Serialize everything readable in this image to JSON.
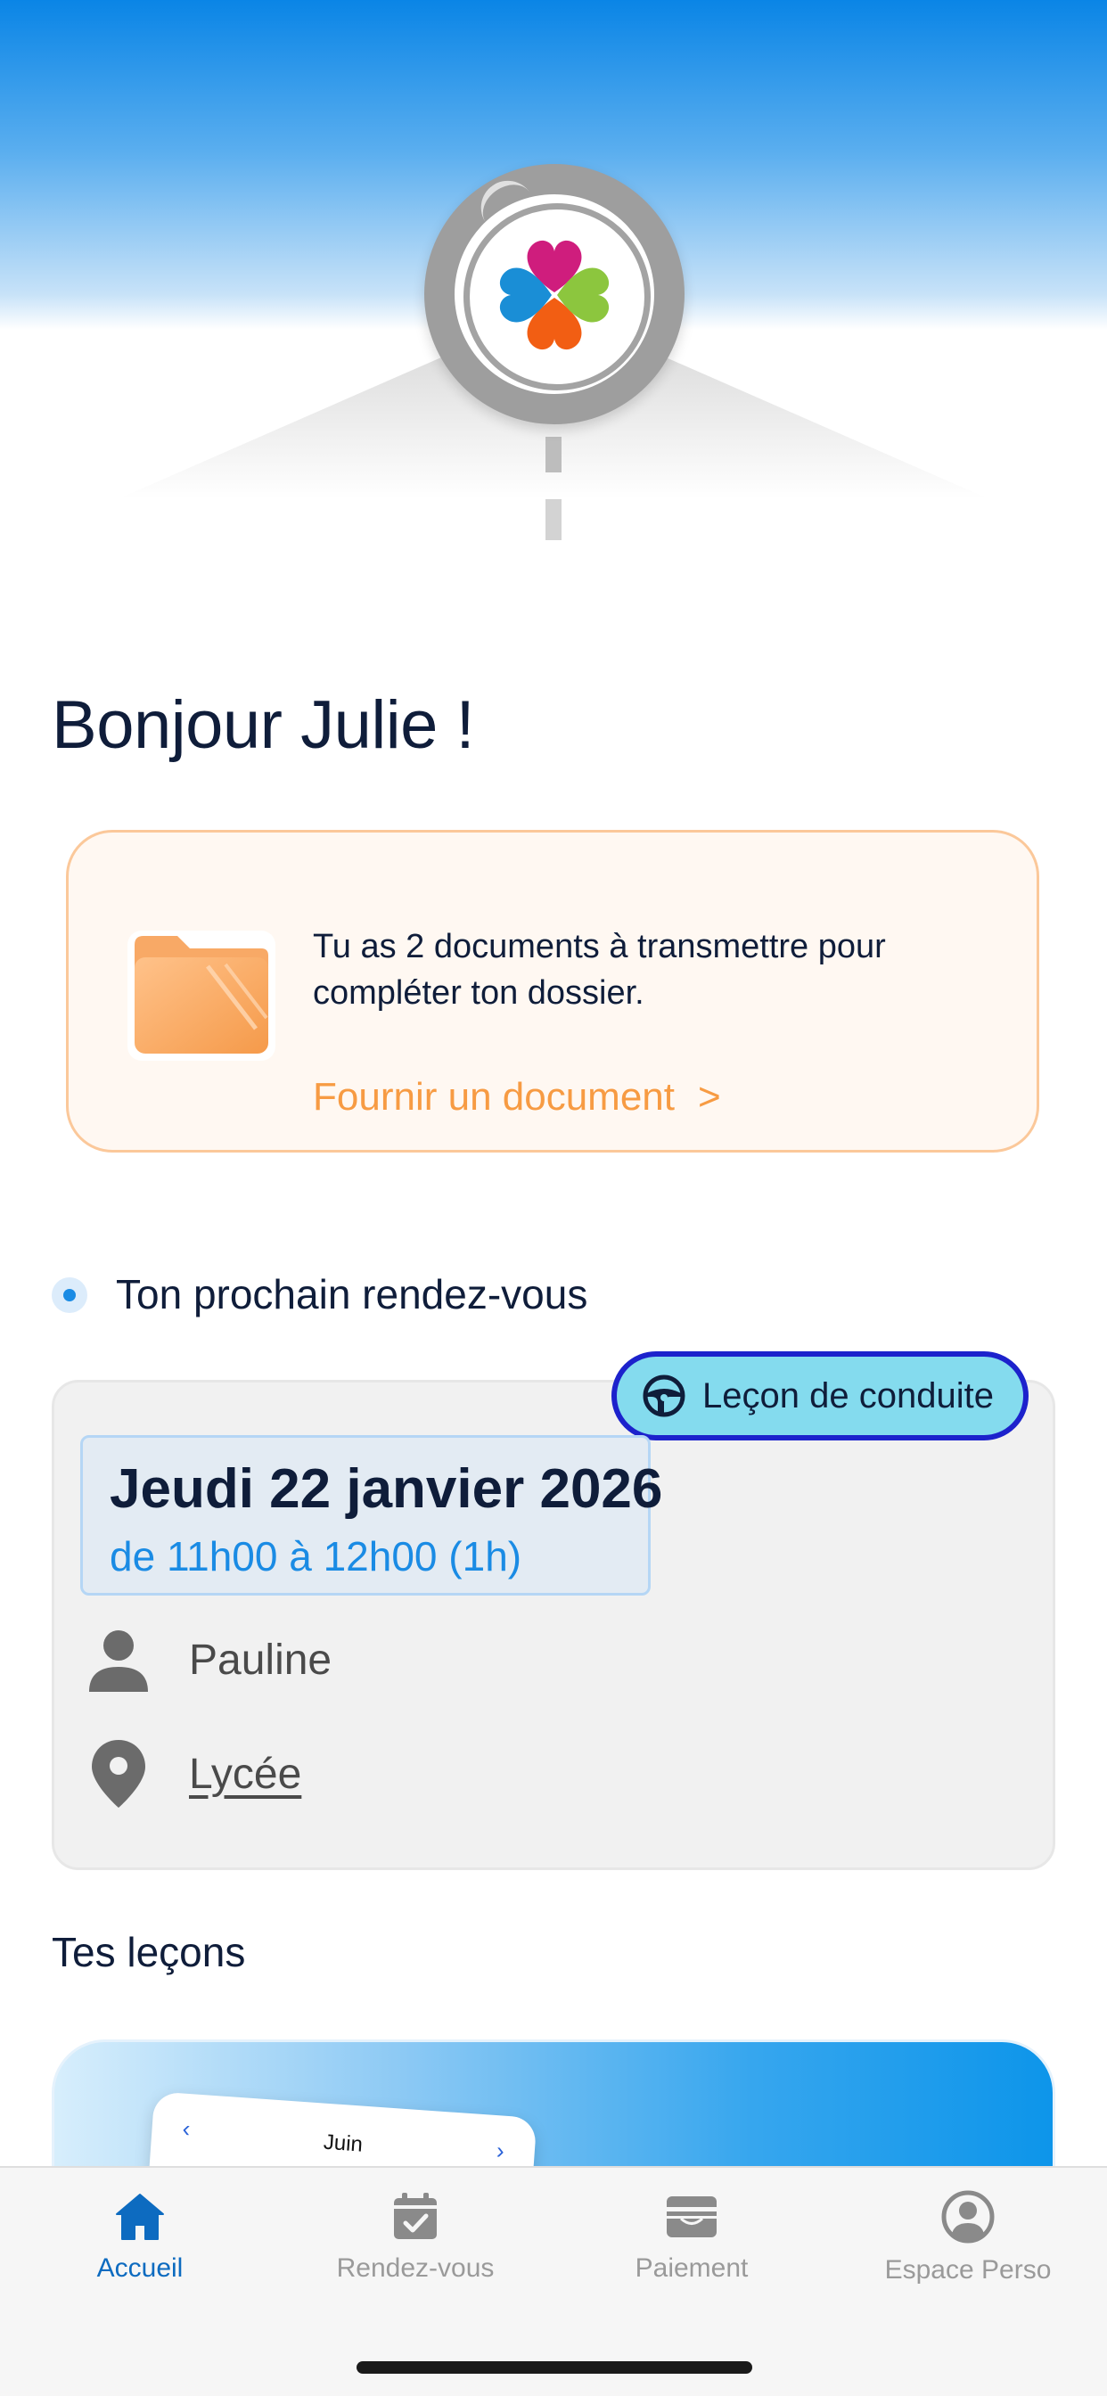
{
  "header": {
    "logo_icon": "clover-road-logo-icon"
  },
  "greeting": "Bonjour Julie !",
  "documents_card": {
    "message": "Tu as 2 documents à transmettre pour compléter ton dossier.",
    "link_label": "Fournir un document",
    "link_chevron": ">",
    "icon": "folder-icon"
  },
  "next_appointment": {
    "section_title": "Ton prochain rendez-vous",
    "type_label": "Leçon de conduite",
    "date": "Jeudi 22 janvier 2026",
    "time": "de 11h00 à 12h00 (1h)",
    "instructor": "Pauline",
    "location": "Lycée"
  },
  "lessons": {
    "section_title": "Tes leçons",
    "calendar_month": "Juin",
    "calendar_prev": "‹",
    "calendar_next": "›"
  },
  "tabbar": {
    "tabs": [
      {
        "label": "Accueil",
        "icon": "home-icon",
        "active": true
      },
      {
        "label": "Rendez-vous",
        "icon": "calendar-check-icon",
        "active": false
      },
      {
        "label": "Paiement",
        "icon": "wallet-icon",
        "active": false
      },
      {
        "label": "Espace Perso",
        "icon": "user-circle-icon",
        "active": false
      }
    ]
  },
  "colors": {
    "primary_blue": "#1a8be4",
    "orange": "#f79b43",
    "pill_bg": "#84dbee",
    "pill_border": "#1c22cc"
  }
}
